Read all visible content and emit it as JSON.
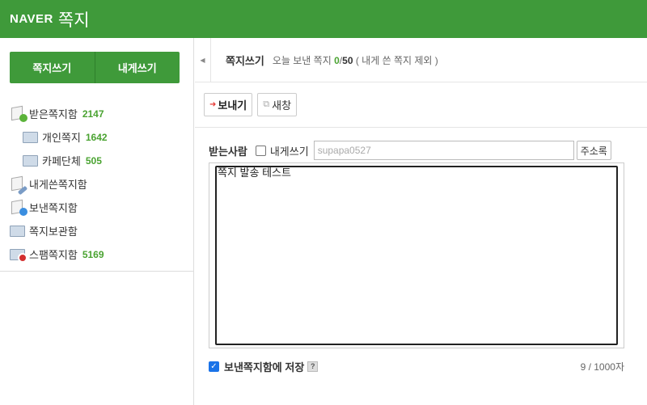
{
  "header": {
    "logo": "NAVER",
    "title": "쪽지"
  },
  "sidebar": {
    "write_button": "쪽지쓰기",
    "self_write_button": "내게쓰기",
    "folders": [
      {
        "label": "받은쪽지함",
        "count": "2147"
      },
      {
        "label": "개인쪽지",
        "count": "1642"
      },
      {
        "label": "카페단체",
        "count": "505"
      },
      {
        "label": "내게쓴쪽지함"
      },
      {
        "label": "보낸쪽지함"
      },
      {
        "label": "쪽지보관함"
      },
      {
        "label": "스팸쪽지함",
        "count": "5169"
      }
    ]
  },
  "main": {
    "title": "쪽지쓰기",
    "today_label": "오늘 보낸 쪽지",
    "sent_count": "0",
    "sep": "/",
    "limit": "50",
    "note": "( 내게 쓴 쪽지 제외 )",
    "send_button": "보내기",
    "new_window_button": "새창",
    "recipient_label": "받는사람",
    "self_label": "내게쓰기",
    "recipient_value": "supapa0527",
    "address_book_button": "주소록",
    "message": "쪽지 발송 테스트",
    "save_label": "보낸쪽지함에 저장",
    "help": "?",
    "char_count": "9 / 1000자"
  },
  "colors": {
    "brand": "#3f9a3a",
    "count": "#4aa331"
  }
}
